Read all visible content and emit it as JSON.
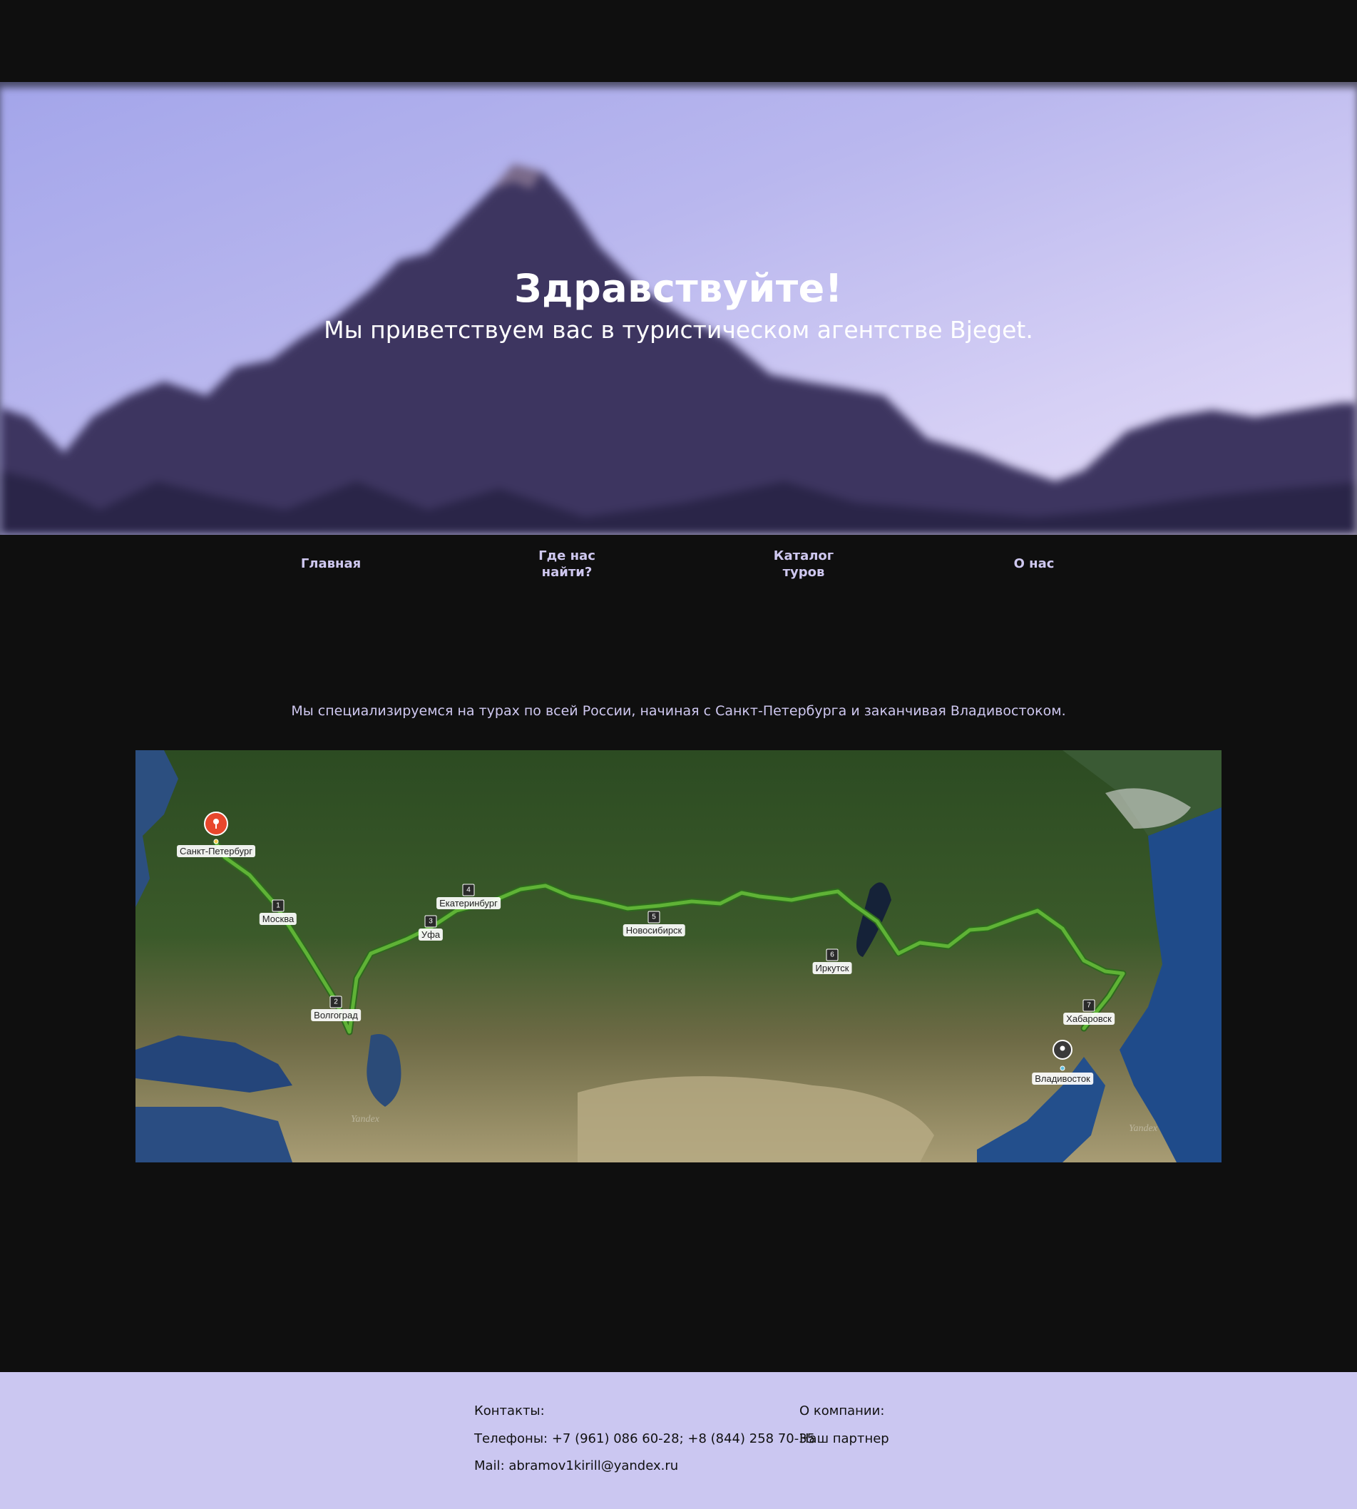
{
  "hero": {
    "title": "Здравствуйте!",
    "subtitle": "Мы приветствуем вас в туристическом агентстве Bjeget."
  },
  "nav": {
    "items": [
      {
        "label": "Главная"
      },
      {
        "label": "Где нас найти?"
      },
      {
        "label": "Каталог туров"
      },
      {
        "label": "О нас"
      }
    ]
  },
  "intro": {
    "text": "Мы специализируемся на турах по всей России, начиная с Санкт-Петербурга и заканчивая Владивостоком."
  },
  "map": {
    "start": "Санкт-Петербург",
    "end": "Владивосток",
    "stops": [
      {
        "num": "1",
        "city": "Москва"
      },
      {
        "num": "2",
        "city": "Волгоград"
      },
      {
        "num": "3",
        "city": "Уфа"
      },
      {
        "num": "4",
        "city": "Екатеринбург"
      },
      {
        "num": "5",
        "city": "Новосибирск"
      },
      {
        "num": "6",
        "city": "Иркутск"
      },
      {
        "num": "7",
        "city": "Хабаровск"
      }
    ],
    "watermark": "Yandex",
    "colors": {
      "route": "#5fb336",
      "start_pin": "#e8472c",
      "end_pin": "#3a3a3a"
    }
  },
  "footer": {
    "contacts_heading": "Контакты:",
    "phones": "Телефоны: +7 (961) 086 60-28; +8 (844) 258 70-35",
    "mail": "Mail: abramov1kirill@yandex.ru",
    "company_heading": "О компании:",
    "partner_link": "Наш партнер"
  }
}
